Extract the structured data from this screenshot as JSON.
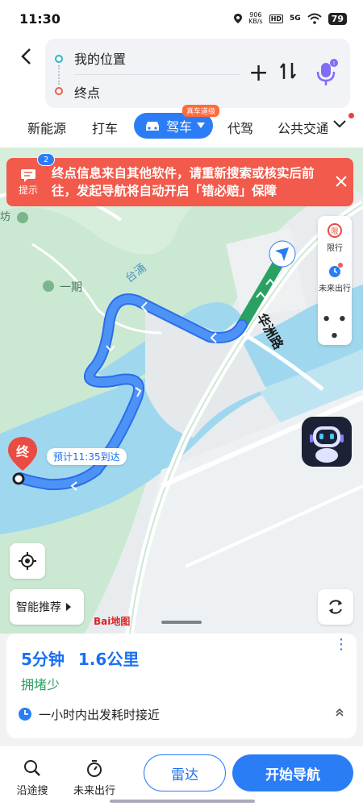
{
  "status": {
    "time": "11:30",
    "net_speed": "906\nKB/s",
    "hd": "HD",
    "signal": "5G",
    "battery": "79"
  },
  "route": {
    "start": "我的位置",
    "end": "终点"
  },
  "tabs": {
    "items": [
      "新能源",
      "打车",
      "驾车",
      "代驾",
      "公共交通"
    ],
    "active": "驾车",
    "active_badge": "真车道级"
  },
  "banner": {
    "tip_label": "提示",
    "tip_count": "2",
    "message": "终点信息来自其他软件，请重新搜索或核实后前往，发起导航将自动开启「错必赔」保障"
  },
  "side_tools": {
    "limit": "限行",
    "future": "未来出行"
  },
  "map_labels": {
    "road": "华洲路",
    "area1": "一期",
    "river": "台涌",
    "poi_cut": "坊",
    "end_pin": "终"
  },
  "eta": "预计11:35到达",
  "map_controls": {
    "smart": "智能推荐",
    "logo": "Bai地图"
  },
  "sheet": {
    "duration": "5分钟",
    "distance": "1.6公里",
    "condition": "拥堵少",
    "hint": "一小时内出发耗时接近"
  },
  "actions": {
    "along": "沿途搜",
    "future": "未来出行",
    "radar": "雷达",
    "start_nav": "开始导航"
  },
  "colors": {
    "accent": "#2b7df6",
    "banner": "#f25a4b",
    "route": "#3d8af5",
    "green": "#2aa163"
  }
}
